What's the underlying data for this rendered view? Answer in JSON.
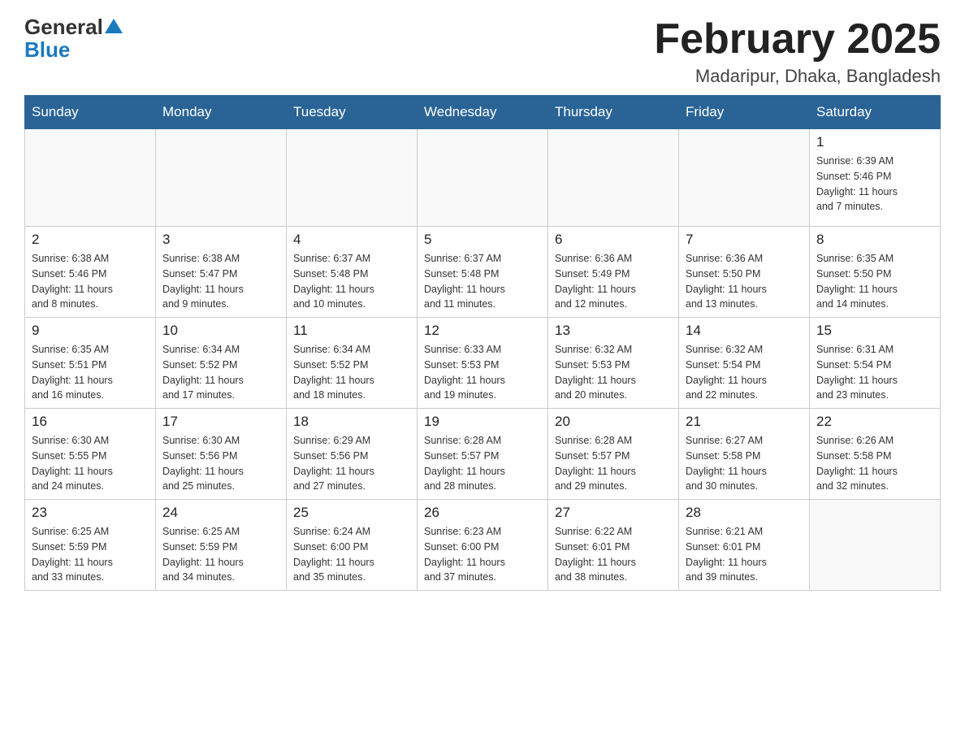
{
  "header": {
    "logo_general": "General",
    "logo_blue": "Blue",
    "title": "February 2025",
    "subtitle": "Madaripur, Dhaka, Bangladesh"
  },
  "weekdays": [
    "Sunday",
    "Monday",
    "Tuesday",
    "Wednesday",
    "Thursday",
    "Friday",
    "Saturday"
  ],
  "weeks": [
    [
      {
        "day": "",
        "info": ""
      },
      {
        "day": "",
        "info": ""
      },
      {
        "day": "",
        "info": ""
      },
      {
        "day": "",
        "info": ""
      },
      {
        "day": "",
        "info": ""
      },
      {
        "day": "",
        "info": ""
      },
      {
        "day": "1",
        "info": "Sunrise: 6:39 AM\nSunset: 5:46 PM\nDaylight: 11 hours\nand 7 minutes."
      }
    ],
    [
      {
        "day": "2",
        "info": "Sunrise: 6:38 AM\nSunset: 5:46 PM\nDaylight: 11 hours\nand 8 minutes."
      },
      {
        "day": "3",
        "info": "Sunrise: 6:38 AM\nSunset: 5:47 PM\nDaylight: 11 hours\nand 9 minutes."
      },
      {
        "day": "4",
        "info": "Sunrise: 6:37 AM\nSunset: 5:48 PM\nDaylight: 11 hours\nand 10 minutes."
      },
      {
        "day": "5",
        "info": "Sunrise: 6:37 AM\nSunset: 5:48 PM\nDaylight: 11 hours\nand 11 minutes."
      },
      {
        "day": "6",
        "info": "Sunrise: 6:36 AM\nSunset: 5:49 PM\nDaylight: 11 hours\nand 12 minutes."
      },
      {
        "day": "7",
        "info": "Sunrise: 6:36 AM\nSunset: 5:50 PM\nDaylight: 11 hours\nand 13 minutes."
      },
      {
        "day": "8",
        "info": "Sunrise: 6:35 AM\nSunset: 5:50 PM\nDaylight: 11 hours\nand 14 minutes."
      }
    ],
    [
      {
        "day": "9",
        "info": "Sunrise: 6:35 AM\nSunset: 5:51 PM\nDaylight: 11 hours\nand 16 minutes."
      },
      {
        "day": "10",
        "info": "Sunrise: 6:34 AM\nSunset: 5:52 PM\nDaylight: 11 hours\nand 17 minutes."
      },
      {
        "day": "11",
        "info": "Sunrise: 6:34 AM\nSunset: 5:52 PM\nDaylight: 11 hours\nand 18 minutes."
      },
      {
        "day": "12",
        "info": "Sunrise: 6:33 AM\nSunset: 5:53 PM\nDaylight: 11 hours\nand 19 minutes."
      },
      {
        "day": "13",
        "info": "Sunrise: 6:32 AM\nSunset: 5:53 PM\nDaylight: 11 hours\nand 20 minutes."
      },
      {
        "day": "14",
        "info": "Sunrise: 6:32 AM\nSunset: 5:54 PM\nDaylight: 11 hours\nand 22 minutes."
      },
      {
        "day": "15",
        "info": "Sunrise: 6:31 AM\nSunset: 5:54 PM\nDaylight: 11 hours\nand 23 minutes."
      }
    ],
    [
      {
        "day": "16",
        "info": "Sunrise: 6:30 AM\nSunset: 5:55 PM\nDaylight: 11 hours\nand 24 minutes."
      },
      {
        "day": "17",
        "info": "Sunrise: 6:30 AM\nSunset: 5:56 PM\nDaylight: 11 hours\nand 25 minutes."
      },
      {
        "day": "18",
        "info": "Sunrise: 6:29 AM\nSunset: 5:56 PM\nDaylight: 11 hours\nand 27 minutes."
      },
      {
        "day": "19",
        "info": "Sunrise: 6:28 AM\nSunset: 5:57 PM\nDaylight: 11 hours\nand 28 minutes."
      },
      {
        "day": "20",
        "info": "Sunrise: 6:28 AM\nSunset: 5:57 PM\nDaylight: 11 hours\nand 29 minutes."
      },
      {
        "day": "21",
        "info": "Sunrise: 6:27 AM\nSunset: 5:58 PM\nDaylight: 11 hours\nand 30 minutes."
      },
      {
        "day": "22",
        "info": "Sunrise: 6:26 AM\nSunset: 5:58 PM\nDaylight: 11 hours\nand 32 minutes."
      }
    ],
    [
      {
        "day": "23",
        "info": "Sunrise: 6:25 AM\nSunset: 5:59 PM\nDaylight: 11 hours\nand 33 minutes."
      },
      {
        "day": "24",
        "info": "Sunrise: 6:25 AM\nSunset: 5:59 PM\nDaylight: 11 hours\nand 34 minutes."
      },
      {
        "day": "25",
        "info": "Sunrise: 6:24 AM\nSunset: 6:00 PM\nDaylight: 11 hours\nand 35 minutes."
      },
      {
        "day": "26",
        "info": "Sunrise: 6:23 AM\nSunset: 6:00 PM\nDaylight: 11 hours\nand 37 minutes."
      },
      {
        "day": "27",
        "info": "Sunrise: 6:22 AM\nSunset: 6:01 PM\nDaylight: 11 hours\nand 38 minutes."
      },
      {
        "day": "28",
        "info": "Sunrise: 6:21 AM\nSunset: 6:01 PM\nDaylight: 11 hours\nand 39 minutes."
      },
      {
        "day": "",
        "info": ""
      }
    ]
  ]
}
